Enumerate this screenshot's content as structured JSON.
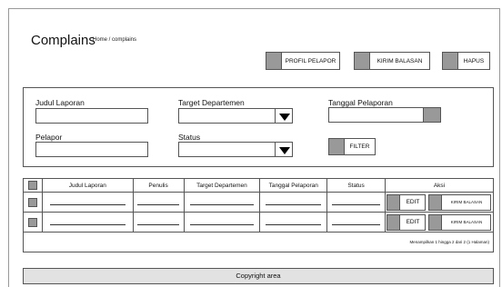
{
  "header": {
    "title": "Complains",
    "breadcrumb": "Home / complains"
  },
  "toolbar": {
    "profil_label": "PROFIL PELAPOR",
    "kirim_label": "KIRIM BALASAN",
    "hapus_label": "HAPUS"
  },
  "filters": {
    "judul_label": "Judul Laporan",
    "judul_value": "",
    "target_label": "Target Departemen",
    "target_value": "",
    "tanggal_label": "Tanggal Pelaporan",
    "tanggal_value": "",
    "pelapor_label": "Pelapor",
    "pelapor_value": "",
    "status_label": "Status",
    "status_value": "",
    "filter_button": "FILTER"
  },
  "table": {
    "columns": [
      "Judul Laporan",
      "Penulis",
      "Target Departemen",
      "Tanggal Pelaporan",
      "Status",
      "Aksi"
    ],
    "row_actions": {
      "edit": "EDIT",
      "kirim": "KIRIM BALASAN"
    },
    "footer": "Menampilkan 1 hingga 2 dari 2 (1 Halaman)"
  },
  "footer": {
    "copyright": "Copyright area"
  },
  "colors": {
    "accent_gray": "#999999",
    "border": "#555555",
    "footer_bg": "#e2e2e2"
  }
}
